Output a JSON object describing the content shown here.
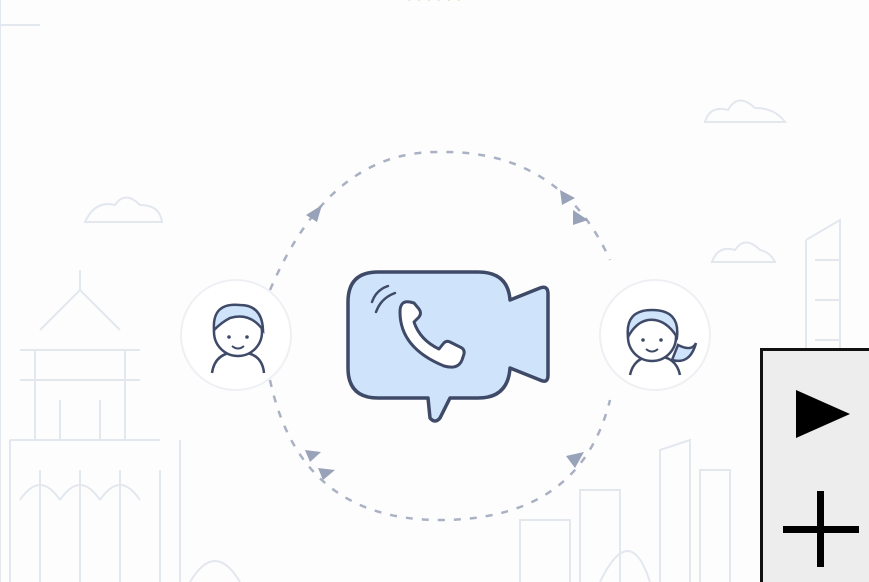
{
  "header": {
    "text": "·  ·  ·  ·  ·  ·"
  },
  "illustration": {
    "center_icon": "video-call-icon",
    "left_avatar": "male-user-icon",
    "right_avatar": "female-user-icon",
    "accent_color": "#cfe4fa",
    "line_color": "#3f4a68",
    "arrow_color": "#98a2b8",
    "background_line_color": "#e3e7ee"
  },
  "controls": {
    "play_icon": "play-icon",
    "add_icon": "plus-icon"
  }
}
